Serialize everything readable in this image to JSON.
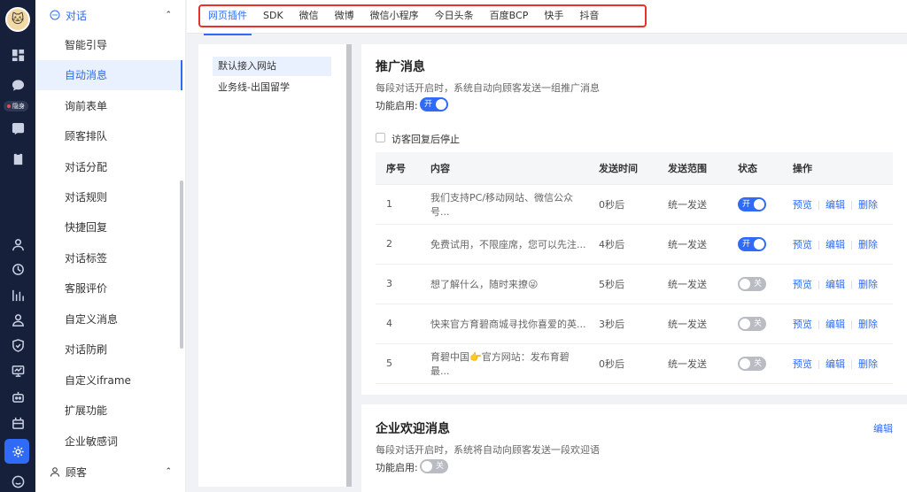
{
  "rail": {
    "stealth_label": "隐身",
    "icons": [
      "dashboard-icon",
      "chat-icon",
      "phone-icon",
      "clipboard-icon",
      "user-icon",
      "clock-chart-icon",
      "bar-chart-icon",
      "team-icon",
      "shield-icon",
      "monitor-icon",
      "plugin-icon",
      "settings-icon",
      "message-icon"
    ]
  },
  "submenu": {
    "group_dialog": "对话",
    "items": [
      "智能引导",
      "自动消息",
      "询前表单",
      "顾客排队",
      "对话分配",
      "对话规则",
      "快捷回复",
      "对话标签",
      "客服评价",
      "自定义消息",
      "对话防刷",
      "自定义iframe",
      "扩展功能",
      "企业敏感词"
    ],
    "active_index": 1,
    "group_customer": "顾客"
  },
  "tabs": [
    "网页插件",
    "SDK",
    "微信",
    "微博",
    "微信小程序",
    "今日头条",
    "百度BCP",
    "快手",
    "抖音"
  ],
  "active_tab": 0,
  "channels": [
    "默认接入网站",
    "业务线-出国留学"
  ],
  "promo": {
    "title": "推广消息",
    "desc": "每段对话开启时，系统自动向顾客发送一组推广消息",
    "enable_label": "功能启用:",
    "enable_state": "开",
    "stop_label": "访客回复后停止",
    "columns": [
      "序号",
      "内容",
      "发送时间",
      "发送范围",
      "状态",
      "操作"
    ],
    "rows": [
      {
        "no": "1",
        "content": "我们支持PC/移动网站、微信公众号...",
        "time": "0秒后",
        "scope": "统一发送",
        "state": "开",
        "on": true
      },
      {
        "no": "2",
        "content": "免费试用，不限座席，您可以先注...",
        "time": "4秒后",
        "scope": "统一发送",
        "state": "开",
        "on": true
      },
      {
        "no": "3",
        "content": "想了解什么，随时来撩😜",
        "time": "5秒后",
        "scope": "统一发送",
        "state": "关",
        "on": false
      },
      {
        "no": "4",
        "content": "快来官方育碧商城寻找你喜爱的英...",
        "time": "3秒后",
        "scope": "统一发送",
        "state": "关",
        "on": false
      },
      {
        "no": "5",
        "content": "育碧中国👉官方网站：发布育碧最...",
        "time": "0秒后",
        "scope": "统一发送",
        "state": "关",
        "on": false
      }
    ],
    "actions": {
      "preview": "预览",
      "edit": "编辑",
      "delete": "删除"
    }
  },
  "welcome": {
    "title": "企业欢迎消息",
    "desc": "每段对话开启时，系统将自动向顾客发送一段欢迎语",
    "enable_label": "功能启用:",
    "enable_state": "关",
    "edit_label": "编辑"
  },
  "colors": {
    "accent": "#2f6bf6",
    "rail": "#16203a",
    "highlight_border": "#e5322d"
  }
}
